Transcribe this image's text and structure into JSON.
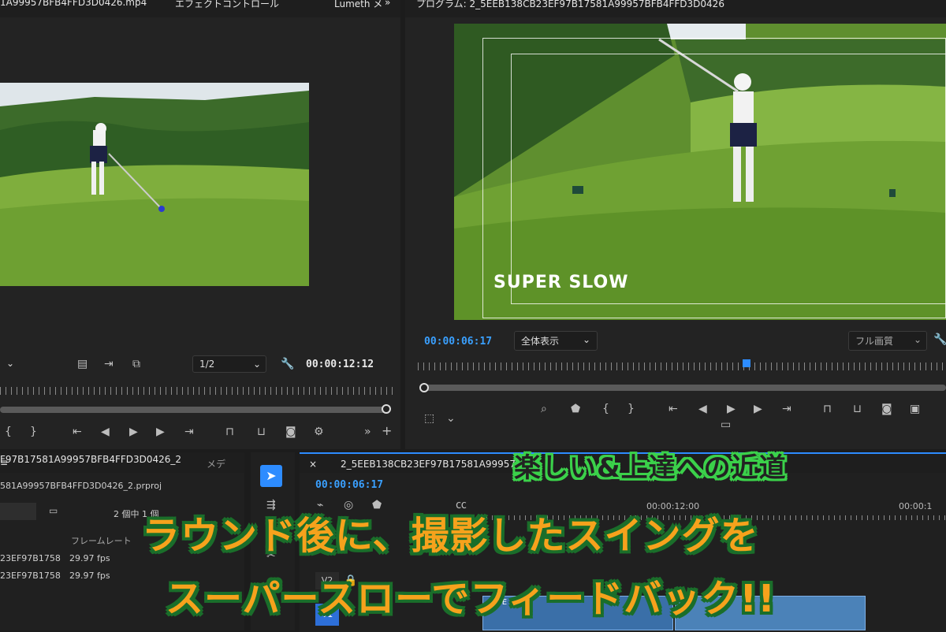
{
  "source_monitor": {
    "tabs": [
      "1A99957BFB4FFD3D0426.mp4",
      "エフェクトコントロール",
      "Lumeth メ"
    ],
    "resolution": "1/2",
    "timecode": "00:00:12:12"
  },
  "program_monitor": {
    "title": "プログラム: 2_5EEB138CB23EF97B17581A99957BFB4FFD3D0426",
    "timecode": "00:00:06:17",
    "zoom": "全体表示",
    "quality": "フル画質",
    "overlay_text": "SUPER SLOW"
  },
  "project_panel": {
    "tab_label": "F97B17581A99957BFB4FFD3D0426_2",
    "tab2_label": "メデ",
    "project_file": "581A99957BFB4FFD3D0426_2.prproj",
    "count_label": "2 個中 1 個",
    "column_header": "フレームレート",
    "rows": [
      {
        "name": "23EF97B1758",
        "fps": "29.97 fps"
      },
      {
        "name": "23EF97B1758",
        "fps": "29.97 fps"
      }
    ]
  },
  "timeline": {
    "title": "2_5EEB138CB23EF97B17581A99957BFB4",
    "timecode": "00:00:06:17",
    "ruler": [
      "00:00:12:00",
      "00:00:1"
    ],
    "tracks": [
      "V1",
      "V2"
    ],
    "clip_label": "2_5E"
  },
  "caption": {
    "line1": "楽しい&上達への近道",
    "line2": "ラウンド後に、撮影したスイングを",
    "line3": "スーパースローでフィードバック!!"
  },
  "colors": {
    "accent_blue": "#2d8cff",
    "caption_green": "#3bd14a",
    "caption_orange": "#f6a21c"
  }
}
